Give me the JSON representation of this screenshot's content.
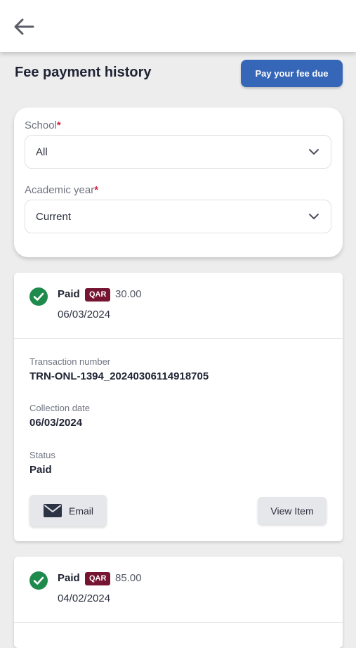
{
  "header": {
    "back_icon": "arrow-left-icon"
  },
  "page": {
    "title": "Fee payment history",
    "pay_button_label": "Pay your fee due"
  },
  "filters": {
    "school": {
      "label": "School",
      "required_mark": "*",
      "value": "All"
    },
    "academic_year": {
      "label": "Academic year",
      "required_mark": "*",
      "value": "Current"
    }
  },
  "labels": {
    "transaction_number": "Transaction number",
    "collection_date": "Collection date",
    "status": "Status",
    "email_button": "Email",
    "view_button": "View Item"
  },
  "transactions": [
    {
      "status": "Paid",
      "currency": "QAR",
      "amount": "30.00",
      "date": "06/03/2024",
      "transaction_number": "TRN-ONL-1394_20240306114918705",
      "collection_date": "06/03/2024",
      "status_value": "Paid"
    },
    {
      "status": "Paid",
      "currency": "QAR",
      "amount": "85.00",
      "date": "04/02/2024"
    }
  ],
  "colors": {
    "primary": "#3566b8",
    "success": "#1e8a4c",
    "currency_badge": "#761532",
    "required": "#d3213f",
    "background": "#ededee"
  }
}
